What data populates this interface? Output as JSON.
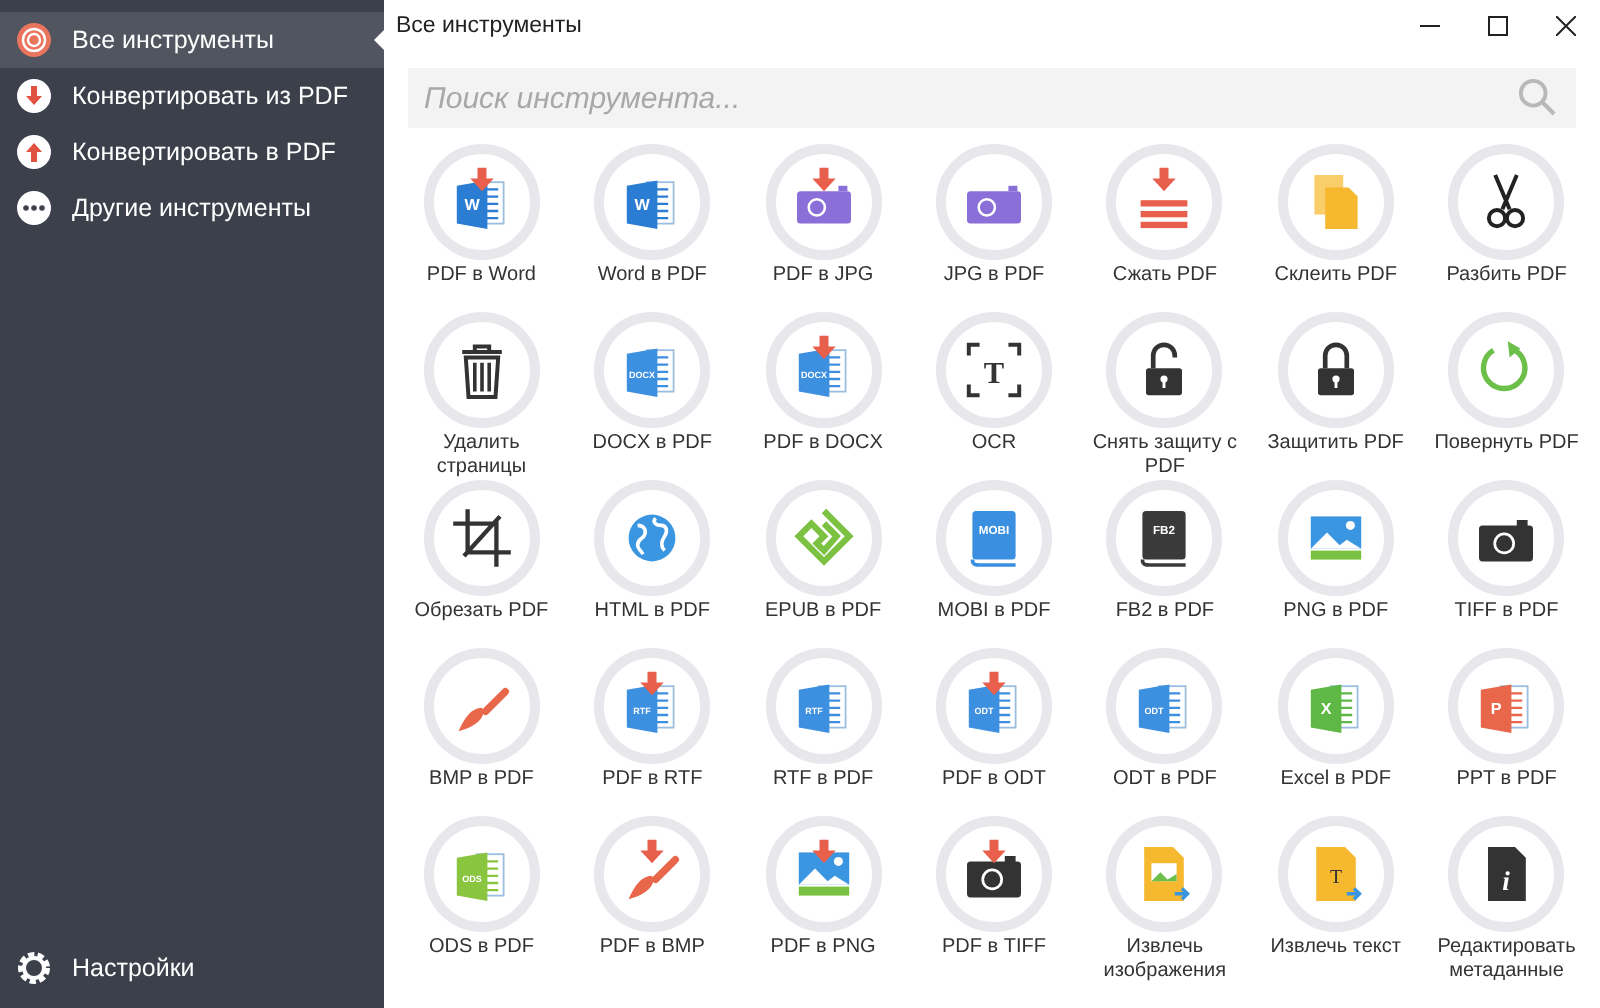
{
  "sidebar": {
    "items": [
      {
        "label": "Все инструменты",
        "kind": "target",
        "selected": true
      },
      {
        "label": "Конвертировать из PDF",
        "kind": "down",
        "selected": false
      },
      {
        "label": "Конвертировать в PDF",
        "kind": "up",
        "selected": false
      },
      {
        "label": "Другие инструменты",
        "kind": "more",
        "selected": false
      }
    ],
    "settings": "Настройки"
  },
  "window": {
    "title": "Все инструменты"
  },
  "search": {
    "placeholder": "Поиск инструмента..."
  },
  "tools": [
    {
      "label": "PDF в Word",
      "kind": "doc",
      "badge": "W",
      "color": "#2b7cd3",
      "arrow": true
    },
    {
      "label": "Word в PDF",
      "kind": "doc",
      "badge": "W",
      "color": "#2b7cd3",
      "arrow": false
    },
    {
      "label": "PDF в JPG",
      "kind": "photo",
      "color": "#8a6fd8",
      "arrow": true
    },
    {
      "label": "JPG в PDF",
      "kind": "photo",
      "color": "#8a6fd8",
      "arrow": false
    },
    {
      "label": "Сжать PDF",
      "kind": "stack",
      "color": "#e8604c",
      "arrow": true
    },
    {
      "label": "Склеить PDF",
      "kind": "merge",
      "color": "#f5b82e"
    },
    {
      "label": "Разбить PDF",
      "kind": "scissors"
    },
    {
      "label": "Удалить страницы",
      "kind": "trash"
    },
    {
      "label": "DOCX в PDF",
      "kind": "doc",
      "badge": "DOCX",
      "color": "#3d8fe0",
      "arrow": false
    },
    {
      "label": "PDF в DOCX",
      "kind": "doc",
      "badge": "DOCX",
      "color": "#3d8fe0",
      "arrow": true
    },
    {
      "label": "OCR",
      "kind": "ocr",
      "badge": "T"
    },
    {
      "label": "Снять защиту с PDF",
      "kind": "lock",
      "open": true
    },
    {
      "label": "Защитить PDF",
      "kind": "lock",
      "open": false
    },
    {
      "label": "Повернуть PDF",
      "kind": "rotate",
      "color": "#6cc04a"
    },
    {
      "label": "Обрезать PDF",
      "kind": "crop"
    },
    {
      "label": "HTML в PDF",
      "kind": "globe",
      "color": "#3a96e0"
    },
    {
      "label": "EPUB в PDF",
      "kind": "epub",
      "color": "#7cc242"
    },
    {
      "label": "MOBI в PDF",
      "kind": "book",
      "badge": "MOBI",
      "color": "#3a8fe0"
    },
    {
      "label": "FB2 в PDF",
      "kind": "book",
      "badge": "FB2",
      "color": "#3a3a3a"
    },
    {
      "label": "PNG в PDF",
      "kind": "image",
      "arrow": false
    },
    {
      "label": "TIFF в PDF",
      "kind": "camera",
      "arrow": false
    },
    {
      "label": "BMP в PDF",
      "kind": "brush",
      "color": "#e8664a",
      "arrow": false
    },
    {
      "label": "PDF в RTF",
      "kind": "doc",
      "badge": "RTF",
      "color": "#3d8fe0",
      "arrow": true
    },
    {
      "label": "RTF в PDF",
      "kind": "doc",
      "badge": "RTF",
      "color": "#3d8fe0",
      "arrow": false
    },
    {
      "label": "PDF в ODT",
      "kind": "doc",
      "badge": "ODT",
      "color": "#3d8fe0",
      "arrow": true
    },
    {
      "label": "ODT в PDF",
      "kind": "doc",
      "badge": "ODT",
      "color": "#3d8fe0",
      "arrow": false
    },
    {
      "label": "Excel в PDF",
      "kind": "doc",
      "badge": "X",
      "color": "#5fb845",
      "arrow": false
    },
    {
      "label": "PPT в PDF",
      "kind": "doc",
      "badge": "P",
      "color": "#e8664a",
      "arrow": false
    },
    {
      "label": "ODS в PDF",
      "kind": "doc",
      "badge": "ODS",
      "color": "#8ac53f",
      "arrow": false
    },
    {
      "label": "PDF в BMP",
      "kind": "brush",
      "color": "#e8664a",
      "arrow": true
    },
    {
      "label": "PDF в PNG",
      "kind": "image",
      "arrow": true
    },
    {
      "label": "PDF в TIFF",
      "kind": "camera",
      "arrow": true
    },
    {
      "label": "Извлечь изображения",
      "kind": "file",
      "color": "#f5b82e"
    },
    {
      "label": "Извлечь текст",
      "kind": "file",
      "badge": "T",
      "color": "#f5b82e"
    },
    {
      "label": "Редактировать метаданные",
      "kind": "info",
      "badge": "i"
    }
  ]
}
